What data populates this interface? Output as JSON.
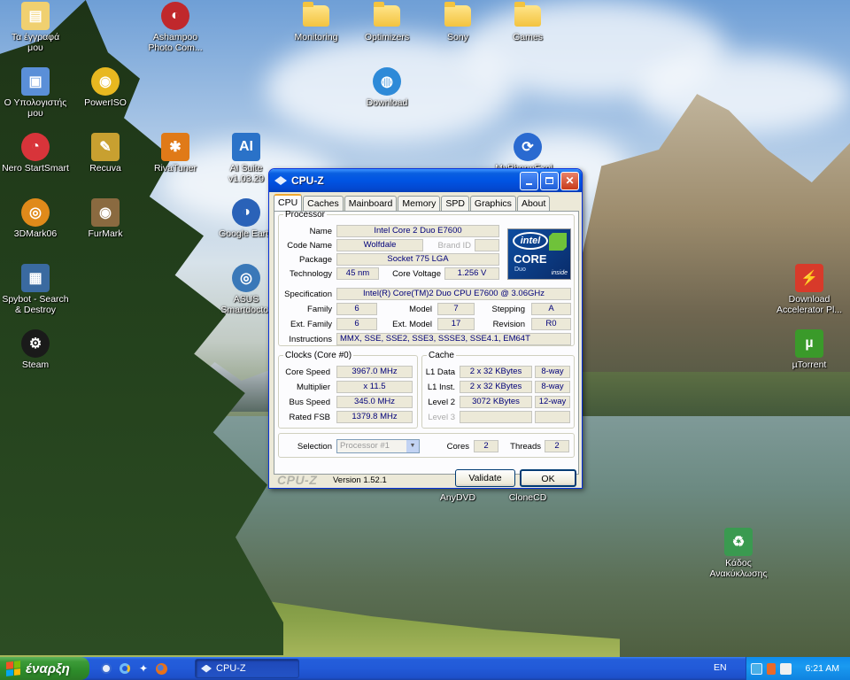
{
  "desktop": {
    "icons": [
      {
        "id": "my-docs",
        "label": "Τα έγγραφά\nμου",
        "glyph": "▤",
        "color": "#f0d070",
        "shape": "square"
      },
      {
        "id": "ashampoo",
        "label": "Ashampoo\nPhoto Com...",
        "glyph": "◐",
        "color": "#c0282c",
        "shape": "round"
      },
      {
        "id": "monitoring",
        "label": "Monitoring",
        "shape": "folder"
      },
      {
        "id": "optimizers",
        "label": "Optimizers",
        "shape": "folder"
      },
      {
        "id": "sony",
        "label": "Sony",
        "shape": "folder"
      },
      {
        "id": "games",
        "label": "Games",
        "shape": "folder"
      },
      {
        "id": "my-computer",
        "label": "Ο Υπολογιστής\nμου",
        "glyph": "▣",
        "color": "#5a8fd8",
        "shape": "square"
      },
      {
        "id": "poweriso",
        "label": "PowerISO",
        "glyph": "◉",
        "color": "#e8b820",
        "shape": "round"
      },
      {
        "id": "download",
        "label": "Download",
        "glyph": "◍",
        "color": "#2e8ad8",
        "shape": "round"
      },
      {
        "id": "nero",
        "label": "Nero StartSmart",
        "glyph": "◔",
        "color": "#d8343a",
        "shape": "round"
      },
      {
        "id": "recuva",
        "label": "Recuva",
        "glyph": "✎",
        "color": "#c8a030",
        "shape": "square"
      },
      {
        "id": "rivatuner",
        "label": "RivaTuner",
        "glyph": "✱",
        "color": "#e07a18",
        "shape": "square"
      },
      {
        "id": "ai-suite",
        "label": "AI Suite\nv1.03.29",
        "glyph": "AI",
        "color": "#2a72c8",
        "shape": "square"
      },
      {
        "id": "myphone",
        "label": "MyPhoneExpl...",
        "glyph": "⟳",
        "color": "#2a6ad0",
        "shape": "round"
      },
      {
        "id": "3dmark",
        "label": "3DMark06",
        "glyph": "◎",
        "color": "#e08a1a",
        "shape": "round"
      },
      {
        "id": "furmark",
        "label": "FurMark",
        "glyph": "◉",
        "color": "#8a6a40",
        "shape": "square"
      },
      {
        "id": "google-earth",
        "label": "Google Earth",
        "glyph": "◑",
        "color": "#2a62b8",
        "shape": "round"
      },
      {
        "id": "spybot",
        "label": "Spybot - Search\n& Destroy",
        "glyph": "▦",
        "color": "#3a6aa0",
        "shape": "square"
      },
      {
        "id": "asus-smartdoctor",
        "label": "ASUS\nSmartdoctor",
        "glyph": "◎",
        "color": "#3a78b8",
        "shape": "round"
      },
      {
        "id": "download-accelerator",
        "label": "Download\nAccelerator Pl...",
        "glyph": "⚡",
        "color": "#d83a2a",
        "shape": "square"
      },
      {
        "id": "steam",
        "label": "Steam",
        "glyph": "⚙",
        "color": "#1a1a1a",
        "shape": "round"
      },
      {
        "id": "utorrent",
        "label": "µTorrent",
        "glyph": "µ",
        "color": "#3a9a2a",
        "shape": "square"
      },
      {
        "id": "anydvd",
        "label": "AnyDVD",
        "shape": "hidden"
      },
      {
        "id": "clonecd",
        "label": "CloneCD",
        "shape": "hidden"
      },
      {
        "id": "recycle-bin",
        "label": "Κάδος\nΑνακύκλωσης",
        "glyph": "♻",
        "color": "#3a9a50",
        "shape": "square"
      }
    ]
  },
  "window": {
    "title": "CPU-Z",
    "tabs": [
      "CPU",
      "Caches",
      "Mainboard",
      "Memory",
      "SPD",
      "Graphics",
      "About"
    ],
    "active_tab": "CPU",
    "processor": {
      "legend": "Processor",
      "name_label": "Name",
      "name": "Intel Core 2 Duo E7600",
      "codename_label": "Code Name",
      "codename": "Wolfdale",
      "brandid_label": "Brand ID",
      "brandid": "",
      "package_label": "Package",
      "package": "Socket 775 LGA",
      "technology_label": "Technology",
      "technology": "45 nm",
      "core_voltage_label": "Core Voltage",
      "core_voltage": "1.256 V",
      "specification_label": "Specification",
      "specification": "Intel(R) Core(TM)2 Duo CPU     E7600  @ 3.06GHz",
      "family_label": "Family",
      "family": "6",
      "model_label": "Model",
      "model": "7",
      "stepping_label": "Stepping",
      "stepping": "A",
      "ext_family_label": "Ext. Family",
      "ext_family": "6",
      "ext_model_label": "Ext. Model",
      "ext_model": "17",
      "revision_label": "Revision",
      "revision": "R0",
      "instructions_label": "Instructions",
      "instructions": "MMX, SSE, SSE2, SSE3, SSSE3, SSE4.1, EM64T",
      "logo": {
        "brand": "intel",
        "line": "CORE",
        "sub": "Duo",
        "inside": "inside"
      }
    },
    "clocks": {
      "legend": "Clocks (Core #0)",
      "core_speed_label": "Core Speed",
      "core_speed": "3967.0 MHz",
      "multiplier_label": "Multiplier",
      "multiplier": "x 11.5",
      "bus_speed_label": "Bus Speed",
      "bus_speed": "345.0 MHz",
      "rated_fsb_label": "Rated FSB",
      "rated_fsb": "1379.8 MHz"
    },
    "cache": {
      "legend": "Cache",
      "l1data_label": "L1 Data",
      "l1data": "2 x 32 KBytes",
      "l1data_way": "8-way",
      "l1inst_label": "L1 Inst.",
      "l1inst": "2 x 32 KBytes",
      "l1inst_way": "8-way",
      "level2_label": "Level 2",
      "level2": "3072 KBytes",
      "level2_way": "12-way",
      "level3_label": "Level 3",
      "level3": "",
      "level3_way": ""
    },
    "selection": {
      "label": "Selection",
      "value": "Processor #1",
      "cores_label": "Cores",
      "cores": "2",
      "threads_label": "Threads",
      "threads": "2"
    },
    "footer": {
      "brand": "CPU-Z",
      "version": "Version 1.52.1",
      "validate": "Validate",
      "ok": "OK"
    }
  },
  "taskbar": {
    "start_label": "έναρξη",
    "task_label": "CPU-Z",
    "language": "EN",
    "clock": "6:21 AM"
  }
}
